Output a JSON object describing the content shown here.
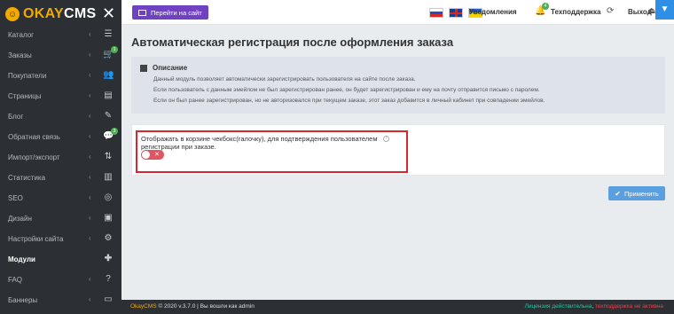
{
  "app": {
    "logo_okay": "OKAY",
    "logo_cms": "CMS"
  },
  "sidebar": {
    "items": [
      {
        "label": "Каталог",
        "icon": "list-icon",
        "glyph": "☰"
      },
      {
        "label": "Заказы",
        "icon": "cart-icon",
        "glyph": "🛒",
        "badge": "1"
      },
      {
        "label": "Покупатели",
        "icon": "users-icon",
        "glyph": "👥"
      },
      {
        "label": "Страницы",
        "icon": "page-icon",
        "glyph": "▤"
      },
      {
        "label": "Блог",
        "icon": "pencil-icon",
        "glyph": "✎"
      },
      {
        "label": "Обратная связь",
        "icon": "chat-icon",
        "glyph": "💬",
        "badge": "3"
      },
      {
        "label": "Импорт/экспорт",
        "icon": "import-export-icon",
        "glyph": "⇅"
      },
      {
        "label": "Статистика",
        "icon": "stats-icon",
        "glyph": "▥"
      },
      {
        "label": "SEO",
        "icon": "target-icon",
        "glyph": "◎"
      },
      {
        "label": "Дизайн",
        "icon": "design-icon",
        "glyph": "▣"
      },
      {
        "label": "Настройки сайта",
        "icon": "gear-icon",
        "glyph": "⚙"
      },
      {
        "label": "Модули",
        "icon": "puzzle-icon",
        "glyph": "✚",
        "active": true
      },
      {
        "label": "FAQ",
        "icon": "question-icon",
        "glyph": "?"
      },
      {
        "label": "Баннеры",
        "icon": "banner-icon",
        "glyph": "▭"
      }
    ]
  },
  "header": {
    "go_site_label": "Перейти на сайт",
    "notifications_label": "Уведомления",
    "notifications_count": "4",
    "support_label": "Техподдержка",
    "logout_label": "Выход"
  },
  "main": {
    "title": "Автоматическая регистрация после оформления заказа",
    "description": {
      "heading": "Описание",
      "lines": [
        "Данный модуль позволяет автоматически зарегистрировать пользователя на сайте после заказа.",
        "Если пользователь с данным эмейлом не был зарегистрирован ранее, он будет зарегистрирован и ему на почту отправится письмо с паролем.",
        "Если он был ранее зарегистрирован, но не авторизовался при текущем заказе, этот заказ добавится в личный кабинет при совпадении эмейлов."
      ]
    },
    "setting": {
      "label": "Отображать в корзине чекбокс(галочку), для подтверждения пользователем регистрации при заказе.",
      "toggle_state": "off",
      "toggle_symbol": "✕"
    },
    "apply_label": "Применить"
  },
  "footer": {
    "brand": "OkayCMS",
    "copyright": "© 2020 v.3.7.0 | Вы вошли как admin",
    "license": "Лицензия действительна",
    "support_status": "техподдержка не активна"
  },
  "colors": {
    "sidebar_bg": "#2c2f33",
    "accent_purple": "#6f42c1",
    "apply_blue": "#5a9fe0",
    "highlight_red": "#d8282e",
    "toggle_off": "#e05561"
  }
}
